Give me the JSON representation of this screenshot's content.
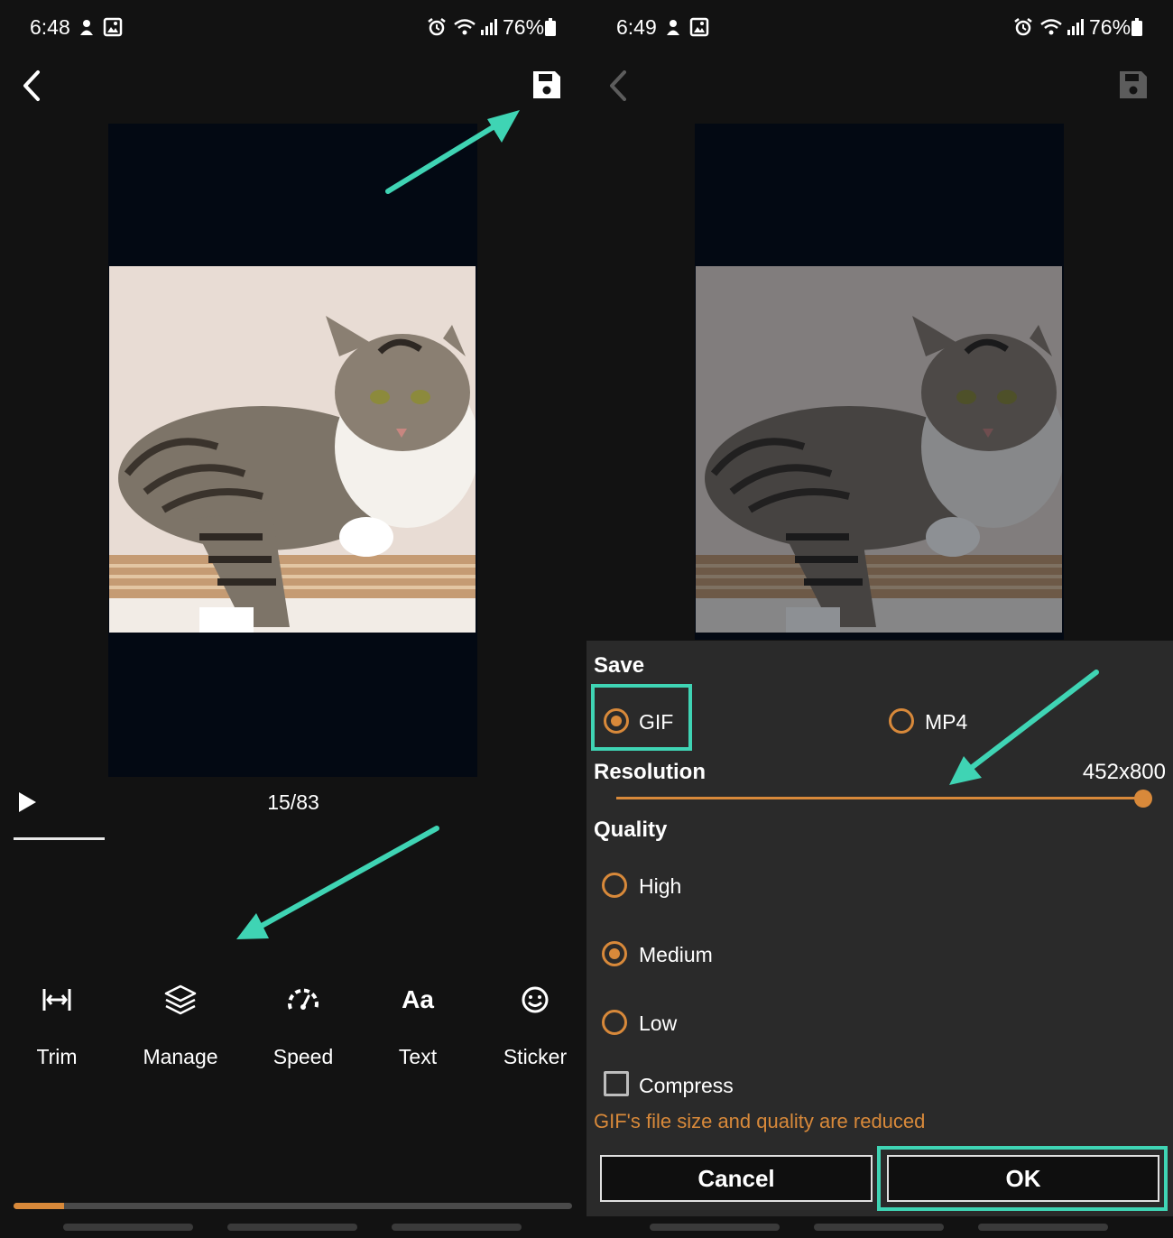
{
  "colors": {
    "accent": "#d8893a",
    "highlight": "#3fd4b4",
    "panel_bg": "#121212",
    "dialog_bg": "#2a2a2a"
  },
  "left": {
    "status": {
      "time": "6:48",
      "battery": "76%"
    },
    "frame_counter": "15/83",
    "tools": [
      {
        "label": "Trim",
        "icon": "trim-icon"
      },
      {
        "label": "Manage",
        "icon": "layers-icon"
      },
      {
        "label": "Speed",
        "icon": "speed-icon"
      },
      {
        "label": "Text",
        "icon": "text-icon",
        "glyph": "Aa"
      },
      {
        "label": "Sticker",
        "icon": "smiley-icon"
      }
    ],
    "progress_fraction": 0.09
  },
  "right": {
    "status": {
      "time": "6:49",
      "battery": "76%"
    },
    "dialog": {
      "save_title": "Save",
      "formats": [
        {
          "label": "GIF",
          "checked": true
        },
        {
          "label": "MP4",
          "checked": false
        }
      ],
      "resolution_title": "Resolution",
      "resolution_value": "452x800",
      "resolution_fraction": 1.0,
      "quality_title": "Quality",
      "qualities": [
        {
          "label": "High",
          "checked": false
        },
        {
          "label": "Medium",
          "checked": true
        },
        {
          "label": "Low",
          "checked": false
        }
      ],
      "compress_label": "Compress",
      "compress_checked": false,
      "compress_hint": "GIF's file size and quality are reduced",
      "cancel_label": "Cancel",
      "ok_label": "OK"
    }
  }
}
